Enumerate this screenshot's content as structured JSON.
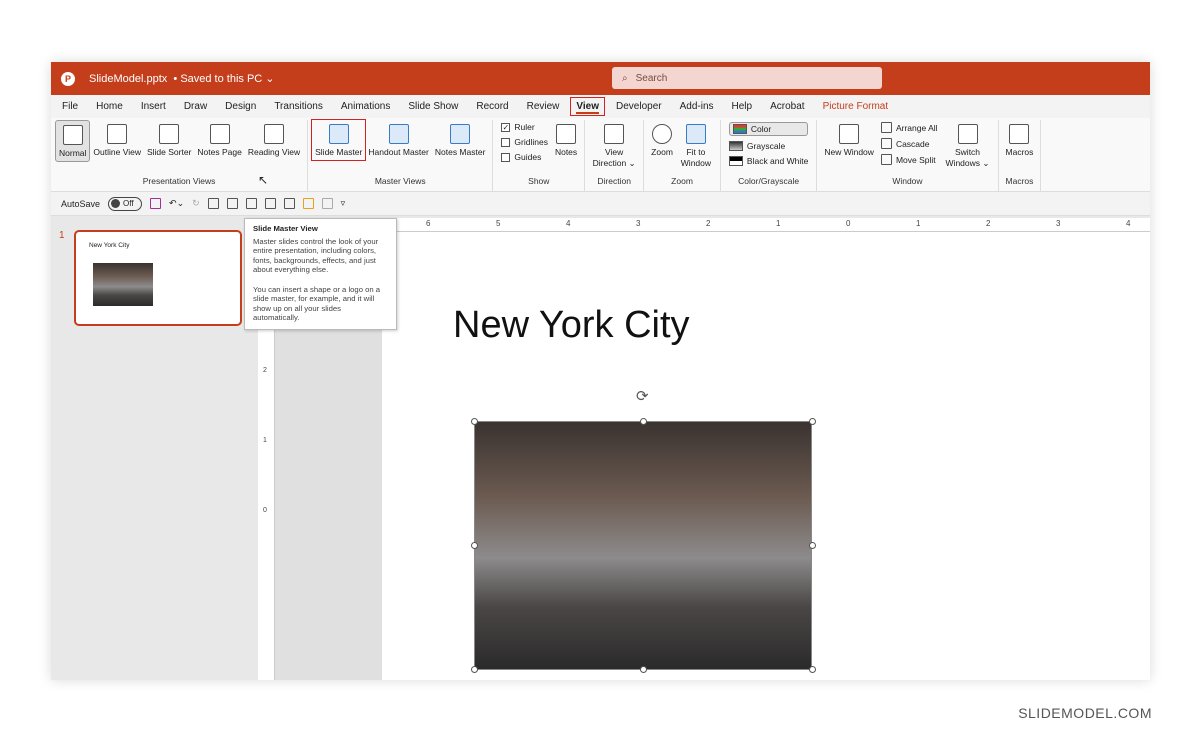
{
  "titlebar": {
    "filename": "SlideModel.pptx",
    "status": "• Saved to this PC ⌄",
    "search_placeholder": "Search"
  },
  "tabs": [
    "File",
    "Home",
    "Insert",
    "Draw",
    "Design",
    "Transitions",
    "Animations",
    "Slide Show",
    "Record",
    "Review",
    "View",
    "Developer",
    "Add-ins",
    "Help",
    "Acrobat",
    "Picture Format"
  ],
  "ribbon": {
    "presentation_views": {
      "label": "Presentation Views",
      "buttons": [
        "Normal",
        "Outline View",
        "Slide Sorter",
        "Notes Page",
        "Reading View"
      ]
    },
    "master_views": {
      "label": "Master Views",
      "buttons": [
        "Slide Master",
        "Handout Master",
        "Notes Master"
      ]
    },
    "show": {
      "label": "Show",
      "checks": [
        {
          "label": "Ruler",
          "checked": true
        },
        {
          "label": "Gridlines",
          "checked": false
        },
        {
          "label": "Guides",
          "checked": false
        }
      ],
      "notes": "Notes"
    },
    "direction": {
      "label": "Direction",
      "button": "View Direction ⌄"
    },
    "zoom": {
      "label": "Zoom",
      "buttons": [
        "Zoom",
        "Fit to Window"
      ]
    },
    "color": {
      "label": "Color/Grayscale",
      "buttons": [
        "Color",
        "Grayscale",
        "Black and White"
      ]
    },
    "window": {
      "label": "Window",
      "new": "New Window",
      "small": [
        "Arrange All",
        "Cascade",
        "Move Split"
      ],
      "switch": "Switch Windows ⌄"
    },
    "macros": {
      "label": "Macros",
      "button": "Macros"
    }
  },
  "qat": {
    "autosave": "AutoSave",
    "toggle": "Off"
  },
  "thumbnail": {
    "number": "1",
    "title": "New York City"
  },
  "tooltip": {
    "title": "Slide Master View",
    "p1": "Master slides control the look of your entire presentation, including colors, fonts, backgrounds, effects, and just about everything else.",
    "p2": "You can insert a shape or a logo on a slide master, for example, and it will show up on all your slides automatically."
  },
  "ruler": {
    "h": [
      "6",
      "5",
      "4",
      "3",
      "2",
      "1",
      "0",
      "1",
      "2",
      "3",
      "4"
    ],
    "v": [
      "2",
      "1",
      "0"
    ]
  },
  "slide": {
    "title": "New York City"
  },
  "watermark": "SLIDEMODEL.COM",
  "colors": {
    "accent": "#c43e1c",
    "highlight": "#d32020"
  }
}
